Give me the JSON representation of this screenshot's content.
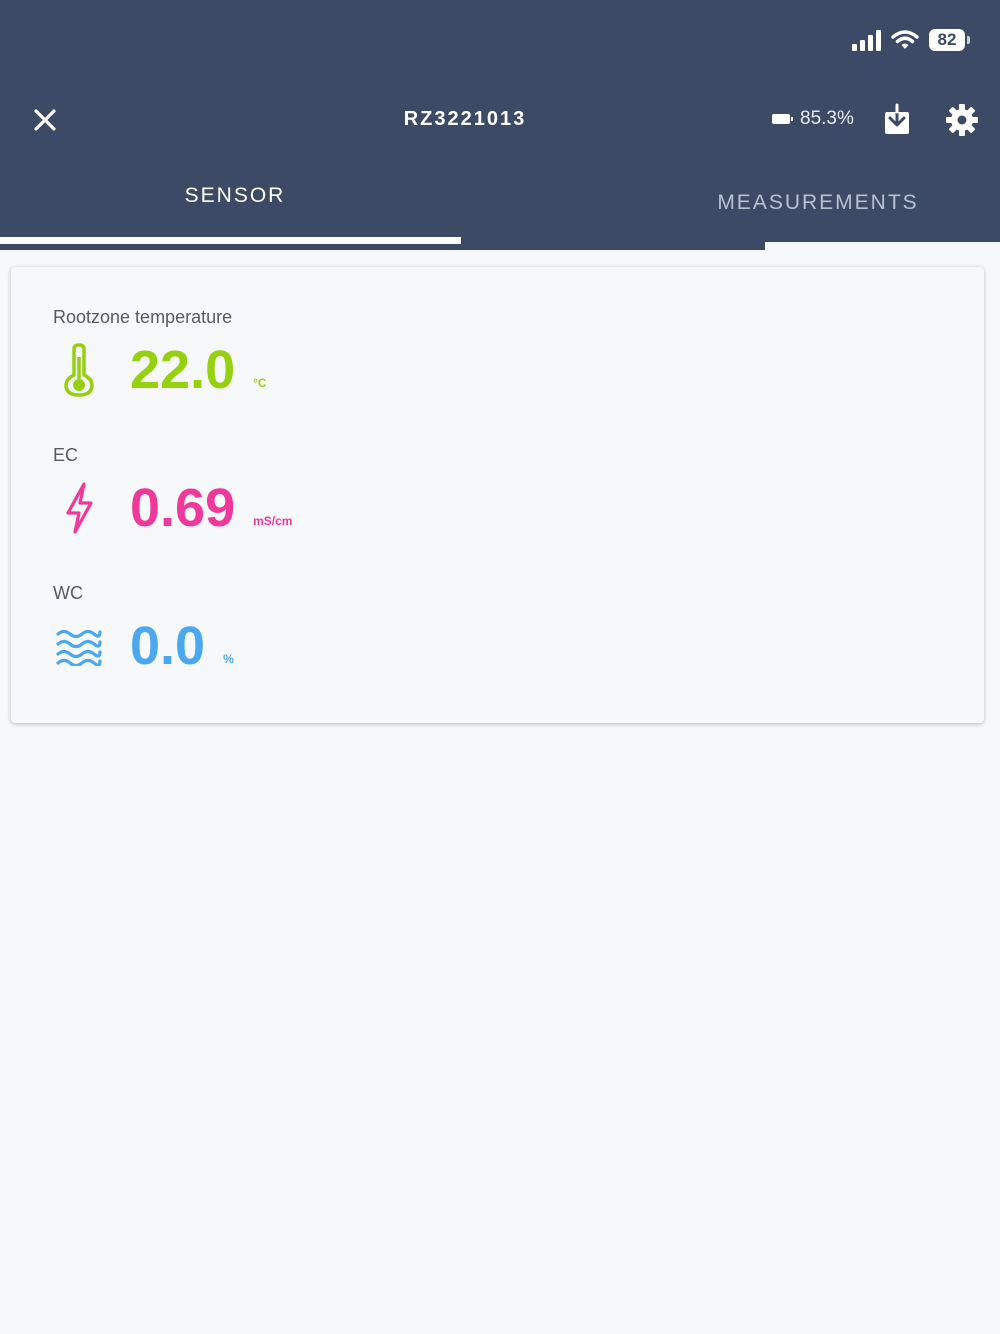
{
  "status_bar": {
    "battery_level": "82"
  },
  "header": {
    "title": "RZ3221013",
    "device_battery": "85.3%"
  },
  "tabs": [
    {
      "label": "SENSOR",
      "active": true
    },
    {
      "label": "MEASUREMENTS",
      "active": false
    }
  ],
  "metrics": [
    {
      "label": "Rootzone temperature",
      "value": "22.0",
      "unit": "°C",
      "icon": "thermometer-icon",
      "color": "#95d10f"
    },
    {
      "label": "EC",
      "value": "0.69",
      "unit": "mS/cm",
      "icon": "lightning-icon",
      "color": "#f0389a"
    },
    {
      "label": "WC",
      "value": "0.0",
      "unit": "%",
      "icon": "waves-icon",
      "color": "#4aa8f0"
    }
  ],
  "colors": {
    "header_bg": "#3d4a66",
    "page_bg": "#f7f8fa"
  }
}
